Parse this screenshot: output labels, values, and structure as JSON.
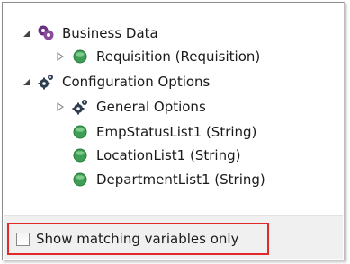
{
  "tree": {
    "nodes": [
      {
        "label": "Business Data",
        "expander": "expanded-triangle-icon",
        "icon": "business-data-icon"
      },
      {
        "label": "Requisition (Requisition)",
        "expander": "collapsed-triangle-icon",
        "icon": "green-variable-icon"
      },
      {
        "label": "Configuration Options",
        "expander": "expanded-triangle-icon",
        "icon": "gears-icon"
      },
      {
        "label": "General Options",
        "expander": "collapsed-triangle-icon",
        "icon": "gears-icon"
      },
      {
        "label": "EmpStatusList1 (String)",
        "expander": "",
        "icon": "green-variable-icon"
      },
      {
        "label": "LocationList1 (String)",
        "expander": "",
        "icon": "green-variable-icon"
      },
      {
        "label": "DepartmentList1 (String)",
        "expander": "",
        "icon": "green-variable-icon"
      }
    ]
  },
  "filter": {
    "checkbox_label": "Show matching variables only",
    "checked": false,
    "highlight_color": "#e12b2b"
  },
  "colors": {
    "variable_green": "#3f9e55",
    "gear_dark": "#2e3e4f",
    "business_purple": "#6b2f7f"
  }
}
